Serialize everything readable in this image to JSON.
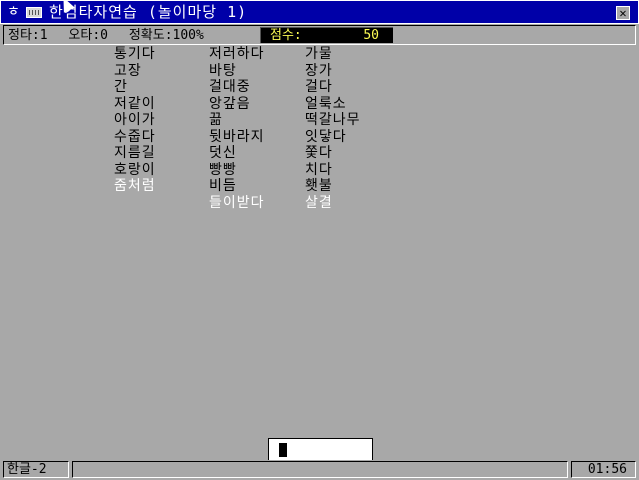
{
  "window": {
    "title": "한컴타자연습 (놀이마당 1)",
    "sys_glyph": "ㅎ",
    "close_glyph": "✕"
  },
  "stats": {
    "correct": "정타:1",
    "wrong": "오타:0",
    "accuracy": "정확도:100%",
    "score_label": "점수:",
    "score_value": "50"
  },
  "columns": [
    {
      "words": [
        {
          "text": "통기다",
          "done": false
        },
        {
          "text": "고장",
          "done": false
        },
        {
          "text": "간",
          "done": false
        },
        {
          "text": "저같이",
          "done": false
        },
        {
          "text": "아이가",
          "done": false
        },
        {
          "text": "수줍다",
          "done": false
        },
        {
          "text": "지름길",
          "done": false
        },
        {
          "text": "호랑이",
          "done": false
        },
        {
          "text": "줌처럼",
          "done": true
        }
      ]
    },
    {
      "words": [
        {
          "text": "저러하다",
          "done": false
        },
        {
          "text": "바탕",
          "done": false
        },
        {
          "text": "걸대중",
          "done": false
        },
        {
          "text": "앙갚음",
          "done": false
        },
        {
          "text": "끎",
          "done": false
        },
        {
          "text": "뒷바라지",
          "done": false
        },
        {
          "text": "덧신",
          "done": false
        },
        {
          "text": "빵빵",
          "done": false
        },
        {
          "text": "비듬",
          "done": false
        },
        {
          "text": "들이받다",
          "done": true
        }
      ]
    },
    {
      "words": [
        {
          "text": "가물",
          "done": false
        },
        {
          "text": "장가",
          "done": false
        },
        {
          "text": "걸다",
          "done": false
        },
        {
          "text": "얼룩소",
          "done": false
        },
        {
          "text": "떡갈나무",
          "done": false
        },
        {
          "text": "잇닿다",
          "done": false
        },
        {
          "text": "쫓다",
          "done": false
        },
        {
          "text": "치다",
          "done": false
        },
        {
          "text": "횃불",
          "done": false
        },
        {
          "text": "살결",
          "done": true
        }
      ]
    }
  ],
  "input": {
    "value": ""
  },
  "status_bar": {
    "ime_mode": "한글-2",
    "message": "",
    "clock": "01:56"
  },
  "colors": {
    "title_bg": "#0000a8",
    "background": "#a8a8a8",
    "score_text": "#fcfc54",
    "done_word": "#ffffff"
  }
}
